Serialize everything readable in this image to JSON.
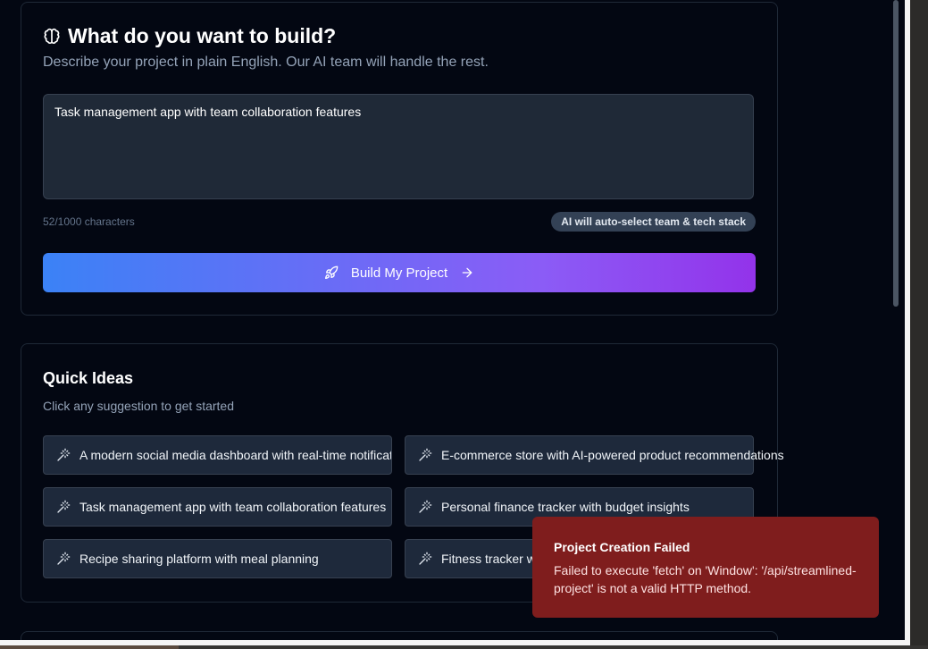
{
  "build_card": {
    "title": "What do you want to build?",
    "subtitle": "Describe your project in plain English. Our AI team will handle the rest.",
    "prompt_value": "Task management app with team collaboration features",
    "char_count": "52/1000 characters",
    "badge": "AI will auto-select team & tech stack",
    "build_button": "Build My Project",
    "icons": {
      "title": "brain-icon",
      "button_left": "rocket-icon",
      "button_right": "arrow-right-icon"
    }
  },
  "quick_ideas": {
    "title": "Quick Ideas",
    "subtitle": "Click any suggestion to get started",
    "items": [
      {
        "label": "A modern social media dashboard with real-time notifications"
      },
      {
        "label": "E-commerce store with AI-powered product recommendations"
      },
      {
        "label": "Task management app with team collaboration features"
      },
      {
        "label": "Personal finance tracker with budget insights"
      },
      {
        "label": "Recipe sharing platform with meal planning"
      },
      {
        "label": "Fitness tracker with workout plans"
      }
    ],
    "item_icon": "magic-wand-icon"
  },
  "toast": {
    "title": "Project Creation Failed",
    "message": "Failed to execute 'fetch' on 'Window': '/api/streamlined-project' is not a valid HTTP method."
  },
  "colors": {
    "background": "#030712",
    "gradient_start": "#3b82f6",
    "gradient_end": "#9333ea",
    "toast_bg": "#7f1d1d"
  }
}
